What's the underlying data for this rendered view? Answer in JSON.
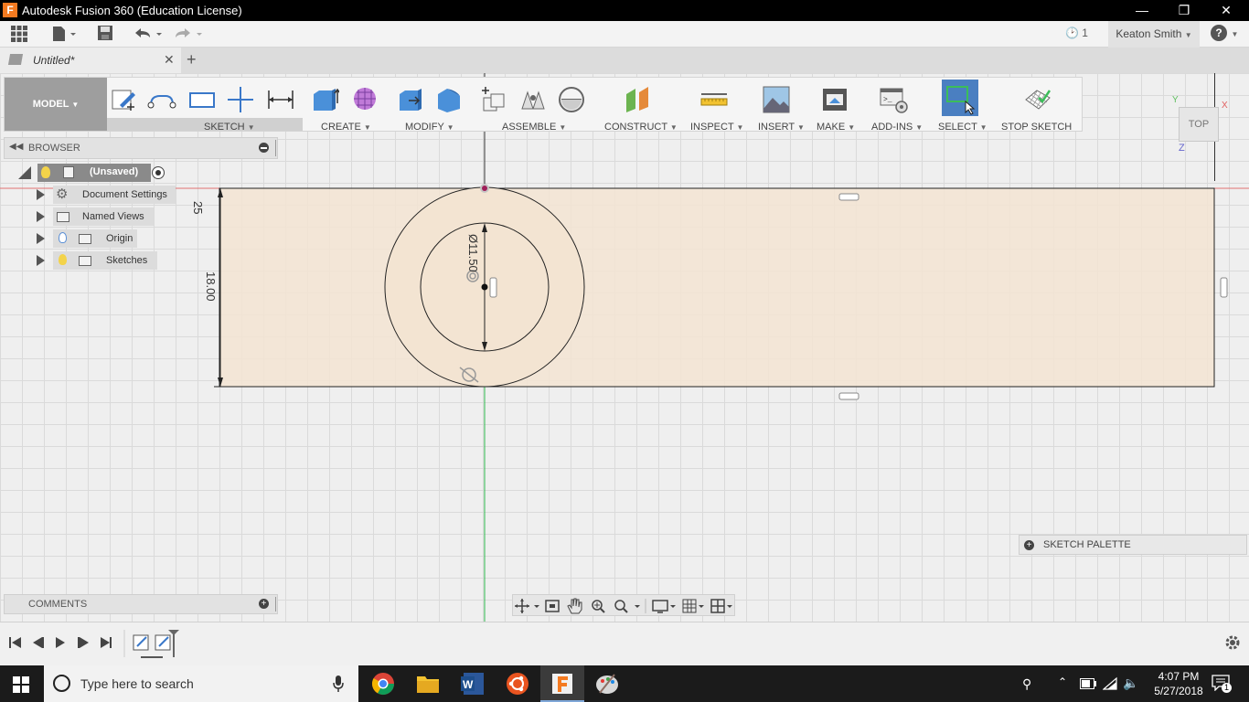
{
  "window": {
    "title": "Autodesk Fusion 360 (Education License)",
    "app_icon_letter": "F"
  },
  "toolbar": {
    "job_count": "1",
    "user_name": "Keaton Smith",
    "help": "?"
  },
  "tabs": [
    {
      "label": "Untitled*"
    }
  ],
  "ribbon": {
    "mode_label": "MODEL",
    "groups": [
      {
        "label": "SKETCH"
      },
      {
        "label": "CREATE"
      },
      {
        "label": "MODIFY"
      },
      {
        "label": "ASSEMBLE"
      },
      {
        "label": "CONSTRUCT"
      },
      {
        "label": "INSPECT"
      },
      {
        "label": "INSERT"
      },
      {
        "label": "MAKE"
      },
      {
        "label": "ADD-INS"
      },
      {
        "label": "SELECT"
      },
      {
        "label": "STOP SKETCH"
      }
    ]
  },
  "browser": {
    "title": "BROWSER",
    "items": [
      {
        "label": "(Unsaved)"
      },
      {
        "label": "Document Settings"
      },
      {
        "label": "Named Views"
      },
      {
        "label": "Origin"
      },
      {
        "label": "Sketches"
      }
    ]
  },
  "sketch": {
    "dim_height": "18.00",
    "dim_top": "25",
    "dim_diameter": "Ø11.50"
  },
  "viewcube": {
    "face": "TOP",
    "axis_x": "X",
    "axis_y": "Y",
    "axis_z": "Z"
  },
  "comments": {
    "title": "COMMENTS"
  },
  "palette": {
    "title": "SKETCH PALETTE"
  },
  "taskbar": {
    "search_placeholder": "Type here to search",
    "time": "4:07 PM",
    "date": "5/27/2018",
    "notifications": "1"
  }
}
